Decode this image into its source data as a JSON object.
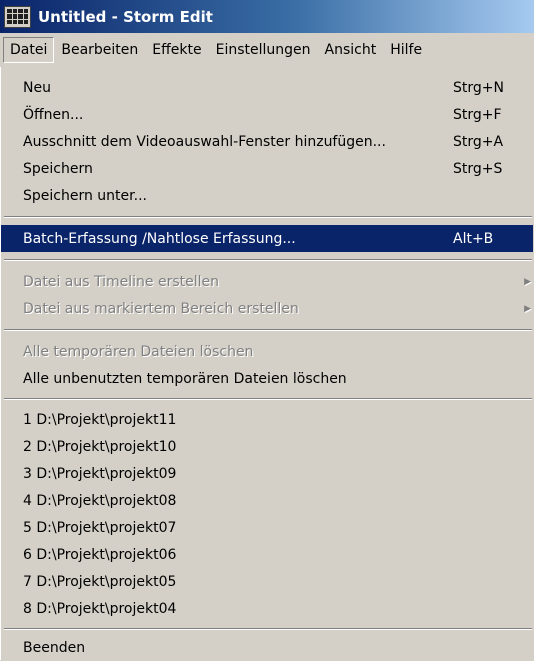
{
  "window": {
    "title": "Untitled - Storm Edit",
    "icon": "storm-edit-app-icon"
  },
  "menubar": {
    "items": [
      {
        "label": "Datei"
      },
      {
        "label": "Bearbeiten"
      },
      {
        "label": "Effekte"
      },
      {
        "label": "Einstellungen"
      },
      {
        "label": "Ansicht"
      },
      {
        "label": "Hilfe"
      }
    ]
  },
  "menu": {
    "group1": [
      {
        "label": "Neu",
        "shortcut": "Strg+N"
      },
      {
        "label": "Öffnen...",
        "shortcut": "Strg+F"
      },
      {
        "label": "Ausschnitt dem Videoauswahl-Fenster hinzufügen...",
        "shortcut": "Strg+A"
      },
      {
        "label": "Speichern",
        "shortcut": "Strg+S"
      },
      {
        "label": "Speichern unter..."
      }
    ],
    "batch": {
      "label": "Batch-Erfassung /Nahtlose Erfassung...",
      "shortcut": "Alt+B"
    },
    "group3": [
      {
        "label": "Datei aus Timeline erstellen",
        "disabled": true,
        "submenu": true
      },
      {
        "label": "Datei aus markiertem Bereich erstellen",
        "disabled": true,
        "submenu": true
      }
    ],
    "group4": [
      {
        "label": "Alle temporären Dateien löschen",
        "disabled": true
      },
      {
        "label": "Alle unbenutzten temporären Dateien löschen"
      }
    ],
    "recent": [
      {
        "label": "1 D:\\Projekt\\projekt11"
      },
      {
        "label": "2 D:\\Projekt\\projekt10"
      },
      {
        "label": "3 D:\\Projekt\\projekt09"
      },
      {
        "label": "4 D:\\Projekt\\projekt08"
      },
      {
        "label": "5 D:\\Projekt\\projekt07"
      },
      {
        "label": "6 D:\\Projekt\\projekt06"
      },
      {
        "label": "7 D:\\Projekt\\projekt05"
      },
      {
        "label": "8 D:\\Projekt\\projekt04"
      }
    ],
    "exit": {
      "label": "Beenden"
    }
  },
  "colors": {
    "highlight": "#0a246a",
    "face": "#d4d0c8",
    "disabled": "#808080"
  }
}
